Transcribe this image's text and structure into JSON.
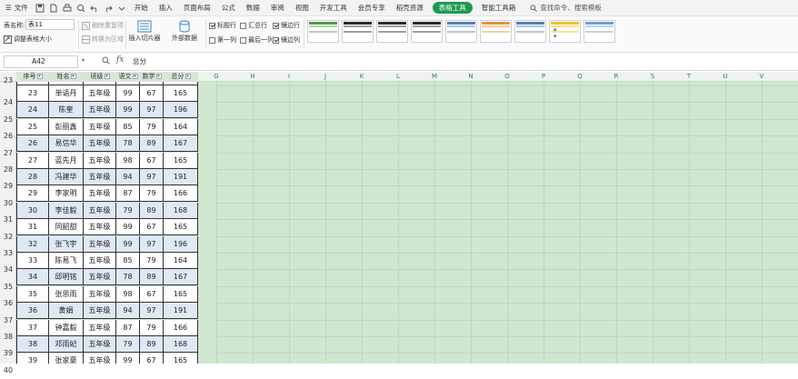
{
  "menubar": {
    "file_label": "文件",
    "tabs": [
      "开始",
      "插入",
      "页面布局",
      "公式",
      "数据",
      "审阅",
      "视图",
      "开发工具",
      "会员专享",
      "稻壳资源"
    ],
    "active_tab": "表格工具",
    "extra_tab": "智能工具箱",
    "search_placeholder": "查找命令、搜索模板"
  },
  "ribbon": {
    "table_name_label": "表名称:",
    "table_name_value": "表11",
    "resize_label": "调整表格大小",
    "remove_dup_label": "删除重复项",
    "to_range_label": "转换为区域",
    "slicer_label": "插入切片器",
    "external_data_label": "外部数据",
    "checkbox_header": "标题行",
    "checkbox_total": "汇总行",
    "checkbox_banded_rows": "镶边行",
    "checkbox_first_col": "第一列",
    "checkbox_last_col": "最后一列",
    "checkbox_banded_cols": "镶边列",
    "style_colors": [
      "#4b9d4b",
      "#2a2a2a",
      "#2a2a2a",
      "#2a2a2a",
      "#4f81bd",
      "#e3923c",
      "#4f81bd",
      "#f2c21b",
      "#6a9fd8"
    ]
  },
  "formula_bar": {
    "name_box": "A42",
    "fx": "fx",
    "formula": "总分"
  },
  "columns": {
    "table_headers": [
      "序号",
      "姓名",
      "班级",
      "语文",
      "数学",
      "总分"
    ],
    "others": [
      "G",
      "H",
      "I",
      "J",
      "K",
      "L",
      "M",
      "N",
      "O",
      "P",
      "Q",
      "R",
      "S",
      "T",
      "U",
      "V"
    ]
  },
  "rows": {
    "numbers": [
      "23",
      "24",
      "25",
      "26",
      "27",
      "28",
      "29",
      "30",
      "31",
      "32",
      "33",
      "34",
      "35",
      "36",
      "37",
      "38",
      "39",
      "40"
    ],
    "cells": [
      [
        "23",
        "单语丹",
        "五年级",
        "99",
        "67",
        "165"
      ],
      [
        "24",
        "陈奎",
        "五年级",
        "99",
        "97",
        "196"
      ],
      [
        "25",
        "彭丽鑫",
        "五年级",
        "85",
        "79",
        "164"
      ],
      [
        "26",
        "易信华",
        "五年级",
        "78",
        "89",
        "167"
      ],
      [
        "27",
        "蓝先月",
        "五年级",
        "98",
        "67",
        "165"
      ],
      [
        "28",
        "冯建华",
        "五年级",
        "94",
        "97",
        "191"
      ],
      [
        "29",
        "李家明",
        "五年级",
        "87",
        "79",
        "166"
      ],
      [
        "30",
        "李佳毅",
        "五年级",
        "79",
        "89",
        "168"
      ],
      [
        "31",
        "同韶甜",
        "五年级",
        "99",
        "67",
        "165"
      ],
      [
        "32",
        "张飞宇",
        "五年级",
        "99",
        "97",
        "196"
      ],
      [
        "33",
        "陈易飞",
        "五年级",
        "85",
        "79",
        "164"
      ],
      [
        "34",
        "邱明铭",
        "五年级",
        "78",
        "89",
        "167"
      ],
      [
        "35",
        "张思雨",
        "五年级",
        "98",
        "67",
        "165"
      ],
      [
        "36",
        "黄娟",
        "五年级",
        "94",
        "97",
        "191"
      ],
      [
        "37",
        "钟嘉毅",
        "五年级",
        "87",
        "79",
        "166"
      ],
      [
        "38",
        "邓雨妃",
        "五年级",
        "79",
        "89",
        "168"
      ],
      [
        "39",
        "张家豪",
        "五年级",
        "99",
        "67",
        "165"
      ]
    ]
  }
}
